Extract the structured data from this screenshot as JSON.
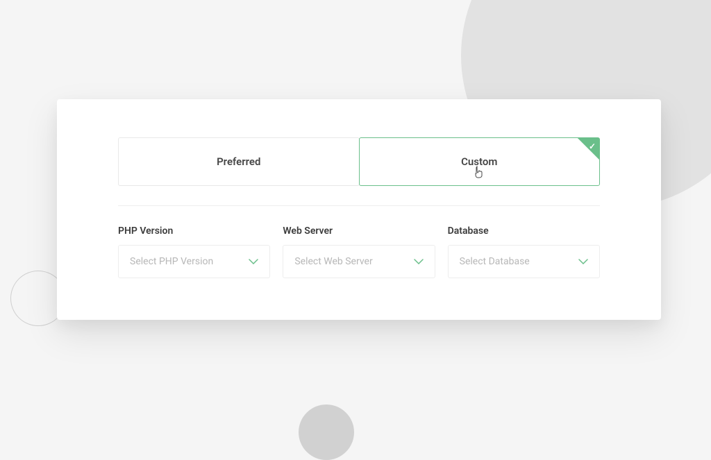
{
  "tabs": {
    "preferred": "Preferred",
    "custom": "Custom"
  },
  "fields": {
    "php": {
      "label": "PHP Version",
      "placeholder": "Select PHP Version"
    },
    "webserver": {
      "label": "Web Server",
      "placeholder": "Select Web Server"
    },
    "database": {
      "label": "Database",
      "placeholder": "Select Database"
    }
  },
  "accent_color": "#6abf8a"
}
